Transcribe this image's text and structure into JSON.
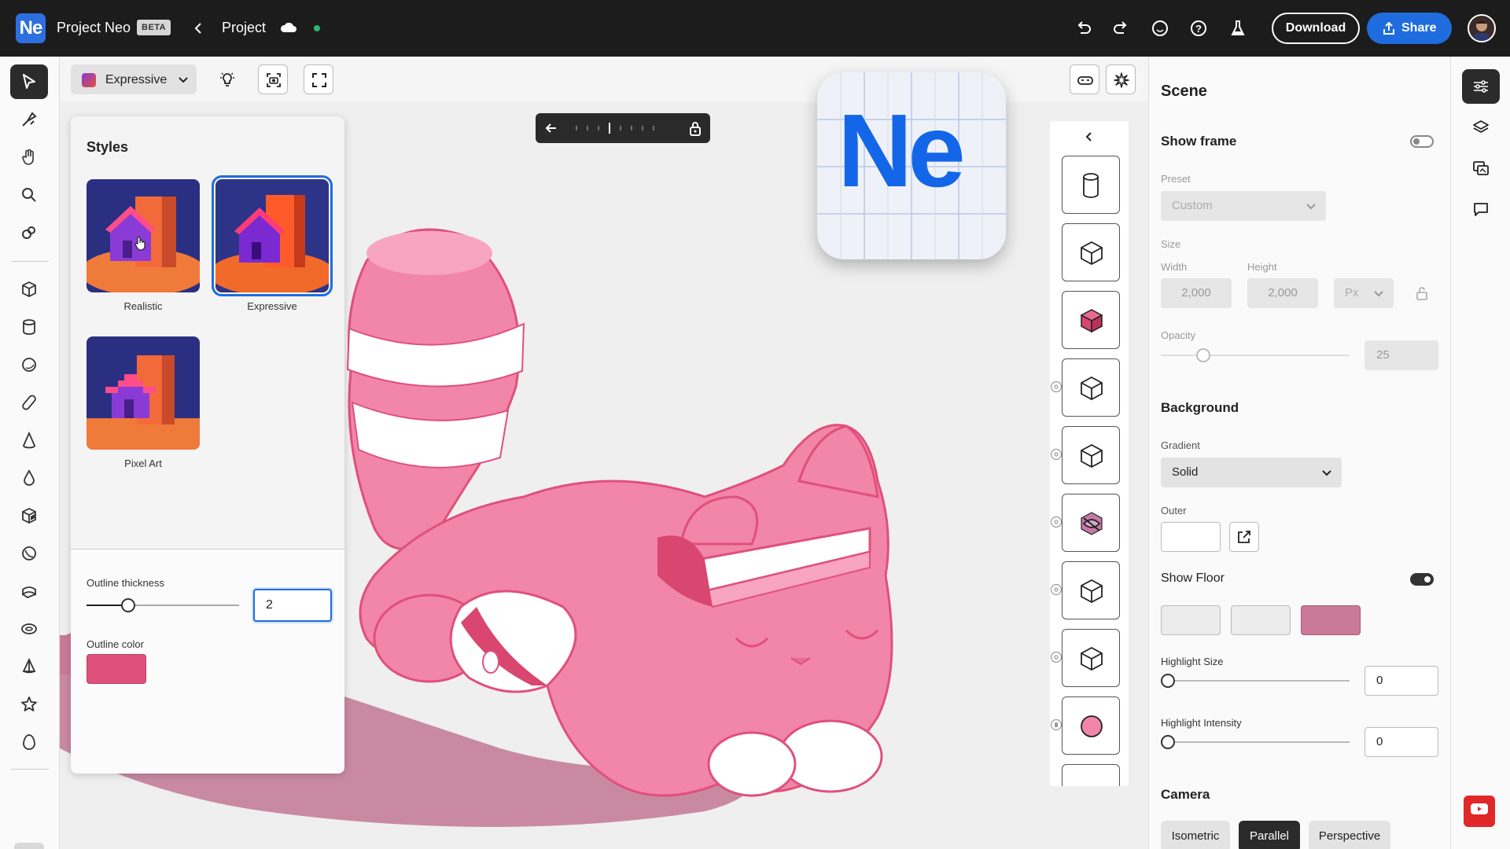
{
  "app": {
    "name": "Project Neo",
    "badge": "BETA",
    "breadcrumb": "Project",
    "sync_status_color": "#2ab573"
  },
  "topbar": {
    "icons": [
      "undo-icon",
      "redo-icon",
      "emoji-icon",
      "help-icon",
      "labs-icon"
    ],
    "download_label": "Download",
    "share_label": "Share"
  },
  "left_tools": [
    "select-icon",
    "pen-icon",
    "hand-icon",
    "zoom-icon",
    "brush-icon",
    "cube-icon",
    "cylinder-icon",
    "sphere-icon",
    "capsule-icon",
    "cone-icon",
    "drop-icon",
    "box-cut-icon",
    "torus-icon",
    "half-cylinder-icon",
    "ring-icon",
    "pyramid-icon",
    "star-icon",
    "egg-icon"
  ],
  "viewport": {
    "style_select": "Expressive",
    "logo_text": "Ne"
  },
  "styles_panel": {
    "title": "Styles",
    "options": [
      {
        "label": "Realistic"
      },
      {
        "label": "Expressive"
      },
      {
        "label": "Pixel Art"
      }
    ],
    "selected": "Expressive",
    "outline_thickness_label": "Outline thickness",
    "outline_thickness_value": "2",
    "outline_color_label": "Outline color",
    "outline_color": "#e0507c"
  },
  "scene_panel": {
    "title": "Scene",
    "show_frame_label": "Show frame",
    "show_frame": false,
    "preset_label": "Preset",
    "preset_value": "Custom",
    "size_label": "Size",
    "width_label": "Width",
    "width_value": "2,000",
    "height_label": "Height",
    "height_value": "2,000",
    "unit_value": "Px",
    "opacity_label": "Opacity",
    "opacity_value": "25",
    "background_title": "Background",
    "gradient_label": "Gradient",
    "gradient_value": "Solid",
    "outer_label": "Outer",
    "show_floor_label": "Show Floor",
    "show_floor": true,
    "floor_accent_color": "#c97a96",
    "highlight_size_label": "Highlight Size",
    "highlight_size_value": "0",
    "highlight_intensity_label": "Highlight Intensity",
    "highlight_intensity_value": "0",
    "camera_title": "Camera",
    "camera_options": [
      "Isometric",
      "Parallel",
      "Perspective"
    ],
    "camera_selected": "Parallel"
  },
  "colors": {
    "accent": "#1f6cde",
    "model_pink": "#f285aa",
    "shadow": "#c98aa1"
  }
}
